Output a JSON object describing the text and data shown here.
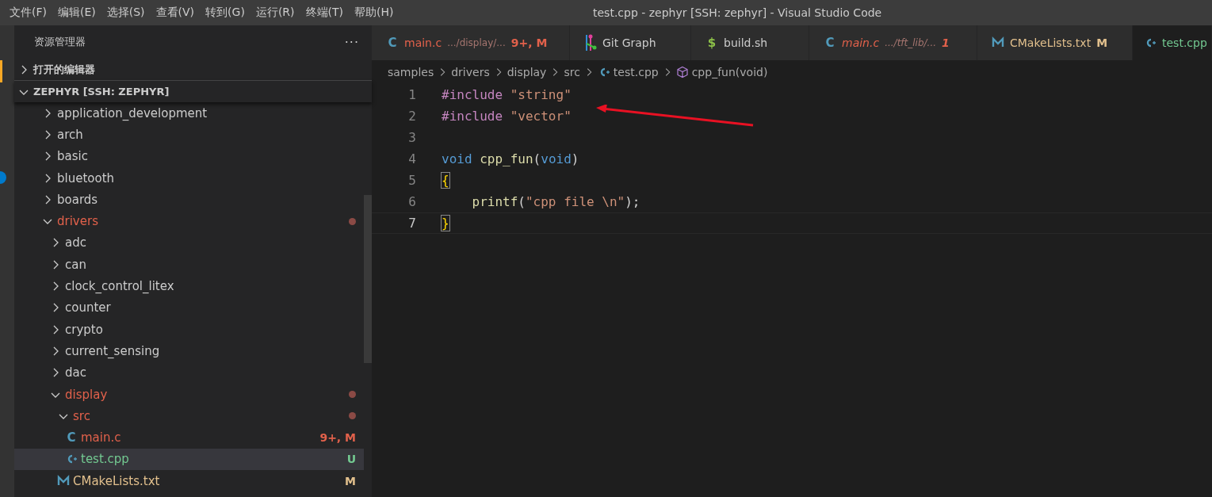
{
  "menu": [
    "文件(F)",
    "编辑(E)",
    "选择(S)",
    "查看(V)",
    "转到(G)",
    "运行(R)",
    "终端(T)",
    "帮助(H)"
  ],
  "window": {
    "title": "test.cpp - zephyr [SSH: zephyr] - Visual Studio Code"
  },
  "sidebar": {
    "title": "资源管理器",
    "more": "···",
    "sections": [
      {
        "label": "打开的编辑器",
        "expanded": false
      },
      {
        "label": "ZEPHYR [SSH: ZEPHYR]",
        "expanded": true
      }
    ],
    "tree": [
      {
        "label": "application_development",
        "kind": "folder",
        "expanded": false,
        "selected": false,
        "color": "#cccccc"
      },
      {
        "label": "arch",
        "kind": "folder",
        "expanded": false,
        "selected": false,
        "color": "#cccccc"
      },
      {
        "label": "basic",
        "kind": "folder",
        "expanded": false,
        "selected": false,
        "color": "#cccccc"
      },
      {
        "label": "bluetooth",
        "kind": "folder",
        "expanded": false,
        "selected": false,
        "color": "#cccccc"
      },
      {
        "label": "boards",
        "kind": "folder",
        "expanded": false,
        "selected": false,
        "color": "#cccccc"
      },
      {
        "label": "drivers",
        "kind": "folder",
        "expanded": true,
        "selected": false,
        "color": "#e2614b",
        "dot": true,
        "children": [
          {
            "label": "adc",
            "kind": "folder",
            "expanded": false,
            "selected": false,
            "color": "#cccccc"
          },
          {
            "label": "can",
            "kind": "folder",
            "expanded": false,
            "selected": false,
            "color": "#cccccc"
          },
          {
            "label": "clock_control_litex",
            "kind": "folder",
            "expanded": false,
            "selected": false,
            "color": "#cccccc"
          },
          {
            "label": "counter",
            "kind": "folder",
            "expanded": false,
            "selected": false,
            "color": "#cccccc"
          },
          {
            "label": "crypto",
            "kind": "folder",
            "expanded": false,
            "selected": false,
            "color": "#cccccc"
          },
          {
            "label": "current_sensing",
            "kind": "folder",
            "expanded": false,
            "selected": false,
            "color": "#cccccc"
          },
          {
            "label": "dac",
            "kind": "folder",
            "expanded": false,
            "selected": false,
            "color": "#cccccc"
          },
          {
            "label": "display",
            "kind": "folder",
            "expanded": true,
            "selected": false,
            "color": "#e2614b",
            "dot": true,
            "children": [
              {
                "label": "src",
                "kind": "folder",
                "expanded": true,
                "selected": false,
                "color": "#e2614b",
                "dot": true,
                "children": [
                  {
                    "label": "main.c",
                    "kind": "c",
                    "icon": "C",
                    "selected": false,
                    "color": "#e2614b",
                    "badge": "9+, M"
                  },
                  {
                    "label": "test.cpp",
                    "kind": "cpp",
                    "selected": true,
                    "color": "#73c991",
                    "badge": "U"
                  }
                ]
              },
              {
                "label": "CMakeLists.txt",
                "kind": "cmake",
                "selected": false,
                "color": "#e2c08d",
                "badge": "M"
              }
            ]
          }
        ]
      }
    ]
  },
  "tabs": [
    {
      "label": "main.c",
      "kind": "c",
      "icon": "C",
      "description": ".../display/...",
      "badge": "9+, M",
      "italic": false,
      "selected": false,
      "color": "#e2614b"
    },
    {
      "label": "Git Graph",
      "kind": "git",
      "italic": false,
      "selected": false,
      "color": "#cccccc"
    },
    {
      "label": "build.sh",
      "kind": "shell",
      "icon": "$",
      "italic": false,
      "selected": false,
      "color": "#cccccc"
    },
    {
      "label": "main.c",
      "kind": "c",
      "icon": "C",
      "description": ".../tft_lib/...",
      "badge": "1",
      "italic": true,
      "selected": false,
      "color": "#e2614b"
    },
    {
      "label": "CMakeLists.txt",
      "kind": "cmake",
      "badge": "M",
      "italic": false,
      "selected": false,
      "color": "#e2c08d"
    },
    {
      "label": "test.cpp",
      "kind": "cpp",
      "italic": false,
      "selected": true,
      "color": "#73c991"
    }
  ],
  "breadcrumbs": [
    {
      "label": "samples",
      "kind": "folder"
    },
    {
      "label": "drivers",
      "kind": "folder"
    },
    {
      "label": "display",
      "kind": "folder"
    },
    {
      "label": "src",
      "kind": "folder"
    },
    {
      "label": "test.cpp",
      "kind": "cpp"
    },
    {
      "label": "cpp_fun(void)",
      "kind": "function"
    }
  ],
  "code": [
    {
      "number": "1",
      "current": false,
      "tokens": [
        {
          "text": "#include ",
          "kind": "directive"
        },
        {
          "text": "\"string\"",
          "kind": "string"
        }
      ]
    },
    {
      "number": "2",
      "current": false,
      "tokens": [
        {
          "text": "#include ",
          "kind": "directive"
        },
        {
          "text": "\"vector\"",
          "kind": "string"
        }
      ]
    },
    {
      "number": "3",
      "current": false
    },
    {
      "number": "4",
      "current": false,
      "tokens": [
        {
          "text": "void ",
          "kind": "keyword"
        },
        {
          "text": "cpp_fun",
          "kind": "function"
        },
        {
          "text": "(",
          "kind": "plain"
        },
        {
          "text": "void",
          "kind": "keyword"
        },
        {
          "text": ")",
          "kind": "plain"
        }
      ]
    },
    {
      "number": "5",
      "current": false,
      "tokens": [
        {
          "text": "{",
          "kind": "bracket"
        }
      ]
    },
    {
      "number": "6",
      "current": false,
      "tokens": [
        {
          "text": "    printf",
          "kind": "function"
        },
        {
          "text": "(",
          "kind": "plain"
        },
        {
          "text": "\"cpp file \\n\"",
          "kind": "string"
        },
        {
          "text": ");",
          "kind": "plain"
        }
      ]
    },
    {
      "number": "7",
      "current": true,
      "tokens": [
        {
          "text": "}",
          "kind": "bracket"
        }
      ]
    }
  ]
}
